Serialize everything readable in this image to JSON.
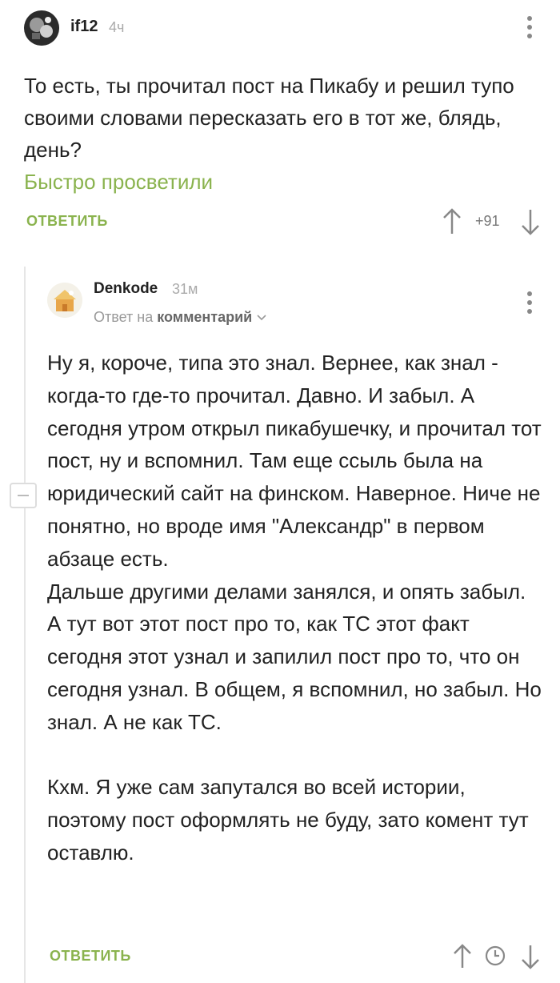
{
  "parent_comment": {
    "author": "if12",
    "time": "4ч",
    "avatar_icon": "avatar-image-icon",
    "text_line_1": "То есть, ты прочитал пост на Пикабу и решил тупо своими словами пересказать его в тот же, блядь, день?",
    "text_green": "Быстро просветили",
    "reply_label": "ОТВЕТИТЬ",
    "rating": "+91"
  },
  "reply_comment": {
    "author": "Denkode",
    "time": "31м",
    "reply_to_prefix": "Ответ на",
    "reply_to_target": "комментарий",
    "text": "Ну я, короче, типа это знал. Вернее, как знал - когда-то где-то прочитал. Давно. И забыл. А сегодня утром открыл пикабушечку, и прочитал тот пост, ну и вспомнил. Там еще ссыль была на юридический сайт на финском. Наверное. Ниче не понятно, но вроде имя \"Александр\" в первом абзаце есть.\nДальше другими делами занялся, и опять забыл.\nА тут вот этот пост про то, как ТС этот факт сегодня этот узнал и запилил пост про то, что он сегодня узнал. В общем, я вспомнил, но забыл. Но знал. А не как ТС.\n\nКхм. Я уже сам запутался во всей истории, поэтому пост оформлять не буду, зато комент тут оставлю.",
    "reply_label": "ОТВЕТИТЬ"
  },
  "colors": {
    "accent_green": "#8ab34e",
    "text": "#222222",
    "muted": "#aaaaaa"
  }
}
